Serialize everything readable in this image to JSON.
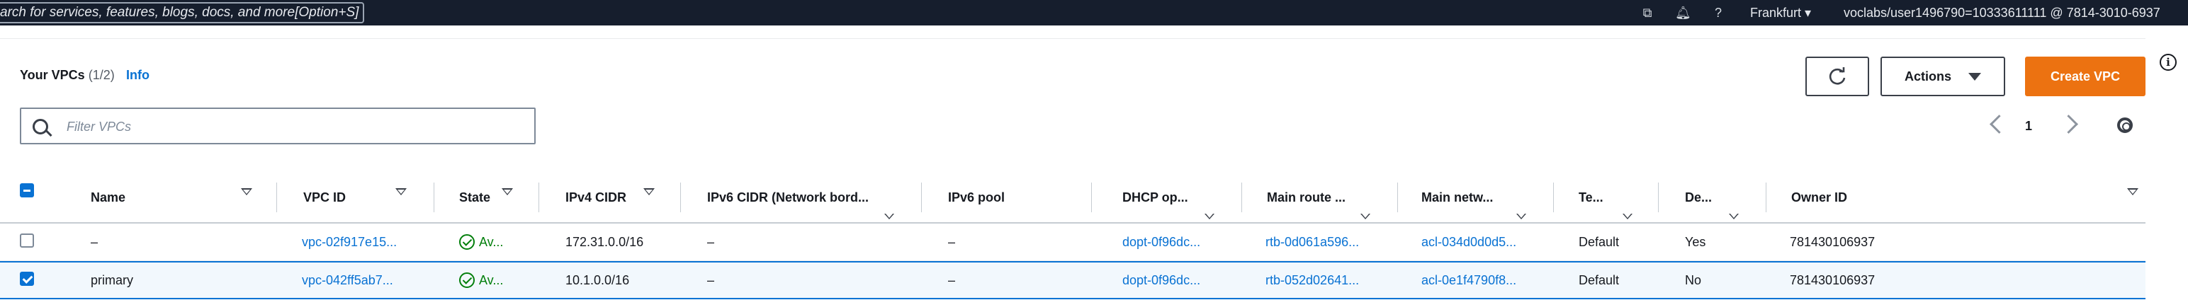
{
  "topbar": {
    "search_text": "arch for services, features, blogs, docs, and more",
    "search_shortcut": "[Option+S]",
    "icons": [
      "cloudshell-icon",
      "bell-icon",
      "help-icon"
    ],
    "region": "Frankfurt",
    "account": "voclabs/user1496790=10333611111 @ 7814-3010-6937"
  },
  "panel": {
    "title": "Your VPCs",
    "count": "(1/2)",
    "info_link": "Info",
    "actions_label": "Actions",
    "create_label": "Create VPC"
  },
  "filter": {
    "placeholder": "Filter VPCs"
  },
  "pagination": {
    "current_page": "1"
  },
  "table": {
    "columns": [
      "Name",
      "VPC ID",
      "State",
      "IPv4 CIDR",
      "IPv6 CIDR (Network bord...",
      "IPv6 pool",
      "DHCP op...",
      "Main route ...",
      "Main netw...",
      "Te...",
      "De...",
      "Owner ID"
    ],
    "rows": [
      {
        "selected": false,
        "name": "–",
        "vpc_id": "vpc-02f917e15...",
        "state": "Av...",
        "ipv4_cidr": "172.31.0.0/16",
        "ipv6_cidr": "–",
        "ipv6_pool": "–",
        "dhcp": "dopt-0f96dc...",
        "route": "rtb-0d061a596...",
        "acl": "acl-034d0d0d5...",
        "tenancy": "Default",
        "default": "Yes",
        "owner": "781430106937"
      },
      {
        "selected": true,
        "name": "primary",
        "vpc_id": "vpc-042ff5ab7...",
        "state": "Av...",
        "ipv4_cidr": "10.1.0.0/16",
        "ipv6_cidr": "–",
        "ipv6_pool": "–",
        "dhcp": "dopt-0f96dc...",
        "route": "rtb-052d02641...",
        "acl": "acl-0e1f4790f8...",
        "tenancy": "Default",
        "default": "No",
        "owner": "781430106937"
      }
    ]
  },
  "colors": {
    "accent": "#0972d3",
    "primary_button": "#ec7211",
    "topbar": "#161e2d",
    "success": "#037f0c"
  }
}
